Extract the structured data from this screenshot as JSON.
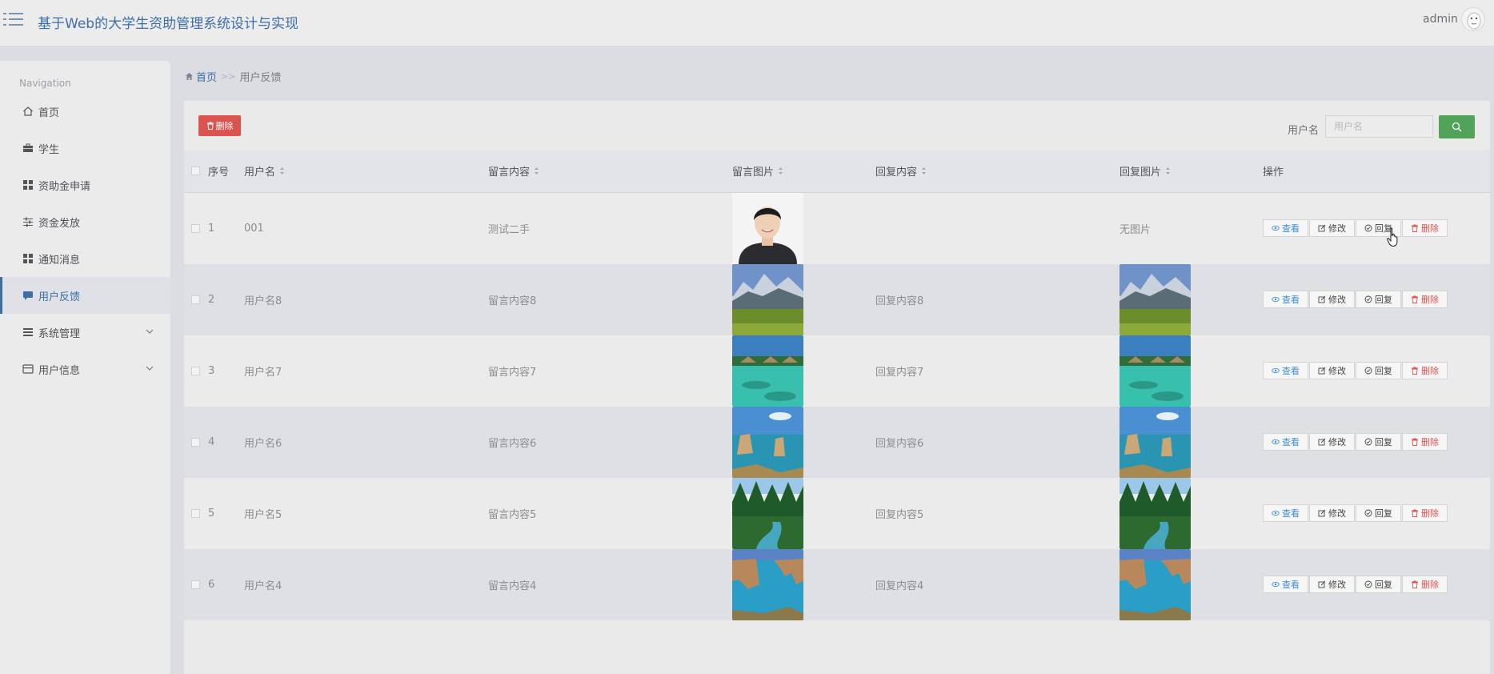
{
  "header": {
    "title": "基于Web的大学生资助管理系统设计与实现",
    "username": "admin"
  },
  "sidebar": {
    "heading": "Navigation",
    "items": [
      {
        "label": "首页",
        "icon": "home-icon"
      },
      {
        "label": "学生",
        "icon": "briefcase-icon"
      },
      {
        "label": "资助金申请",
        "icon": "grid-icon"
      },
      {
        "label": "资金发放",
        "icon": "sliders-icon"
      },
      {
        "label": "通知消息",
        "icon": "grid-icon"
      },
      {
        "label": "用户反馈",
        "icon": "chat-icon",
        "active": true
      },
      {
        "label": "系统管理",
        "icon": "list-icon",
        "expandable": true
      },
      {
        "label": "用户信息",
        "icon": "card-icon",
        "expandable": true
      }
    ]
  },
  "breadcrumb": {
    "home": "首页",
    "separator": ">>",
    "current": "用户反馈"
  },
  "toolbar": {
    "delete_label": "删除",
    "search_label": "用户名",
    "search_placeholder": "用户名"
  },
  "table": {
    "headers": {
      "index": "序号",
      "username": "用户名",
      "message": "留言内容",
      "message_image": "留言图片",
      "reply": "回复内容",
      "reply_image": "回复图片",
      "actions": "操作"
    },
    "rows": [
      {
        "index": "1",
        "username": "001",
        "message": "测试二手",
        "message_image": "portrait",
        "reply": "",
        "reply_image_text": "无图片",
        "reply_image": ""
      },
      {
        "index": "2",
        "username": "用户名8",
        "message": "留言内容8",
        "message_image": "mountain-meadow",
        "reply": "回复内容8",
        "reply_image_text": "",
        "reply_image": "mountain-meadow"
      },
      {
        "index": "3",
        "username": "用户名7",
        "message": "留言内容7",
        "message_image": "tropical-huts",
        "reply": "回复内容7",
        "reply_image_text": "",
        "reply_image": "tropical-huts"
      },
      {
        "index": "4",
        "username": "用户名6",
        "message": "留言内容6",
        "message_image": "sea-rocks",
        "reply": "回复内容6",
        "reply_image_text": "",
        "reply_image": "sea-rocks"
      },
      {
        "index": "5",
        "username": "用户名5",
        "message": "留言内容5",
        "message_image": "forest-river",
        "reply": "回复内容5",
        "reply_image_text": "",
        "reply_image": "forest-river"
      },
      {
        "index": "6",
        "username": "用户名4",
        "message": "留言内容4",
        "message_image": "sea-arch",
        "reply": "回复内容4",
        "reply_image_text": "",
        "reply_image": "sea-arch"
      }
    ],
    "actions": {
      "view": "查看",
      "edit": "修改",
      "reply": "回复",
      "delete": "删除"
    }
  },
  "colors": {
    "brand": "#3d6fa5",
    "danger": "#d9534f",
    "success": "#52a35a",
    "view": "#3d8ed1"
  }
}
